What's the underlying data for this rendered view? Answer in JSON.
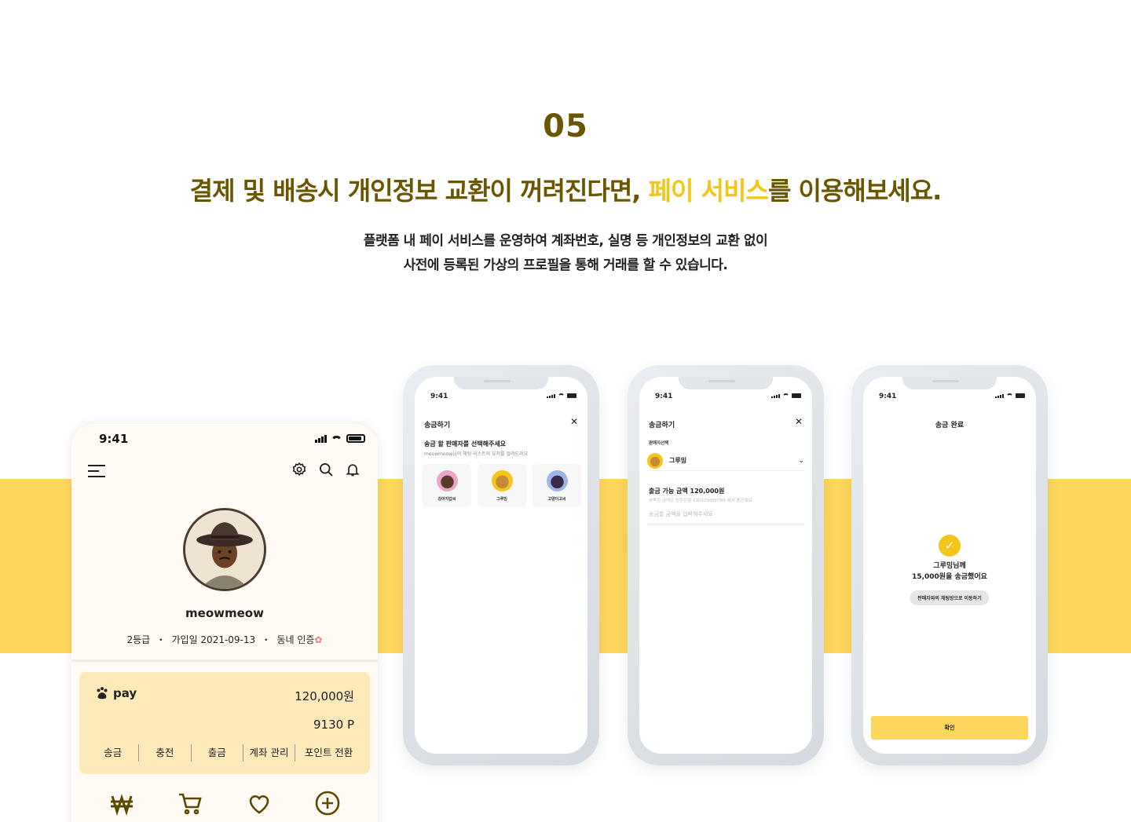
{
  "section": {
    "number": "05",
    "headline_before": "결제 및 배송시 개인정보 교환이 꺼려진다면, ",
    "headline_highlight": "페이 서비스",
    "headline_after": "를 이용해보세요.",
    "desc_line1": "플랫폼 내 페이 서비스를 운영하여 계좌번호, 실명 등 개인정보의 교환 없이",
    "desc_line2": "사전에 등록된 가상의 프로필을 통해 거래를 할 수 있습니다."
  },
  "colors": {
    "brand_dark": "#6b5600",
    "accent_yellow": "#f5c518",
    "band": "#fdd65c",
    "pay_card": "#fdeaba"
  },
  "profile_screen": {
    "time": "9:41",
    "menu_icon": "hamburger-icon",
    "icons": [
      "gear-icon",
      "search-icon",
      "bell-icon"
    ],
    "username": "meowmeow",
    "grade": "2등급",
    "joined": "가입일 2021-09-13",
    "neighborhood": "동네 인증",
    "pay": {
      "logo_text": "pay",
      "balance": "120,000원",
      "points": "9130 P",
      "actions": [
        "송금",
        "충전",
        "출금",
        "계좌 관리",
        "포인트 전환"
      ]
    },
    "tab_icons": [
      "won-icon",
      "cart-icon",
      "heart-icon",
      "plus-circle-icon"
    ]
  },
  "phone1": {
    "time": "9:41",
    "title": "송금하기",
    "question": "송금 할 판매자를 선택해주세요",
    "subtitle": "meowmeow님의 채팅 리스트의 유저를 알려드려요",
    "sellers": [
      {
        "name": "강아지갑씨",
        "color": "#e9a6c8"
      },
      {
        "name": "그루밍",
        "color": "#f5c518"
      },
      {
        "name": "고양이고씨",
        "color": "#9fb4e6"
      }
    ]
  },
  "phone2": {
    "time": "9:41",
    "title": "송금하기",
    "select_label": "판매자선택",
    "selected_seller": "그루밍",
    "available": "출금 가능 금액 120,000원",
    "note": "부족한 금액은 신한은행 110123456789 에서 충전돼요",
    "input_placeholder": "송금할 금액을 입력해주세요"
  },
  "phone3": {
    "time": "9:41",
    "title": "송금 완료",
    "message_line1": "그루밍님께",
    "message_line2": "15,000원을 송금했어요",
    "chat_button": "판매자와의 채팅방으로 이동하기",
    "confirm_button": "확인"
  }
}
